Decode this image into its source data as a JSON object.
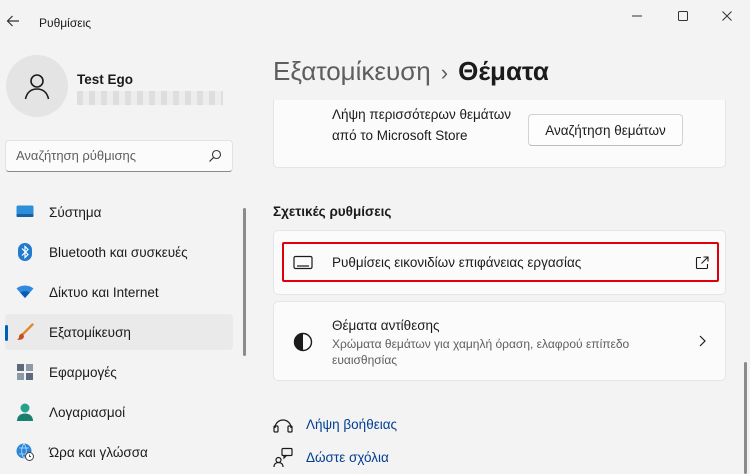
{
  "window": {
    "title": "Ρυθμίσεις",
    "controls": {
      "minimize": "minimize-icon",
      "maximize": "maximize-icon",
      "close": "close-icon"
    }
  },
  "user": {
    "name": "Test Ego"
  },
  "search": {
    "placeholder": "Αναζήτηση ρύθμισης"
  },
  "sidebar": {
    "items": [
      {
        "label": "Σύστημα",
        "icon": "system-icon"
      },
      {
        "label": "Bluetooth και συσκευές",
        "icon": "bluetooth-icon"
      },
      {
        "label": "Δίκτυο και Internet",
        "icon": "network-icon"
      },
      {
        "label": "Εξατομίκευση",
        "icon": "personalization-brush-icon",
        "active": true
      },
      {
        "label": "Εφαρμογές",
        "icon": "apps-icon"
      },
      {
        "label": "Λογαριασμοί",
        "icon": "accounts-icon"
      },
      {
        "label": "Ώρα και γλώσσα",
        "icon": "time-language-icon"
      }
    ]
  },
  "breadcrumb": {
    "parent": "Εξατομίκευση",
    "separator": "›",
    "current": "Θέματα"
  },
  "store_card": {
    "text": "Λήψη περισσότερων θεμάτων από το Microsoft Store",
    "button": "Αναζήτηση θεμάτων"
  },
  "related": {
    "header": "Σχετικές ρυθμίσεις",
    "desktop_icons": {
      "title": "Ρυθμίσεις εικονιδίων επιφάνειας εργασίας",
      "icon": "monitor-icon",
      "trail_icon": "external-link-icon"
    },
    "contrast": {
      "title": "Θέματα αντίθεσης",
      "description": "Χρώματα θεμάτων για χαμηλή όραση, ελαφρού επίπεδο ευαισθησίας",
      "icon": "contrast-icon",
      "trail_icon": "chevron-right-icon"
    }
  },
  "links": {
    "help": "Λήψη βοήθειας",
    "feedback": "Δώστε σχόλια"
  },
  "colors": {
    "accent": "#005fb8",
    "highlight": "#e0000b",
    "link": "#003e92"
  }
}
